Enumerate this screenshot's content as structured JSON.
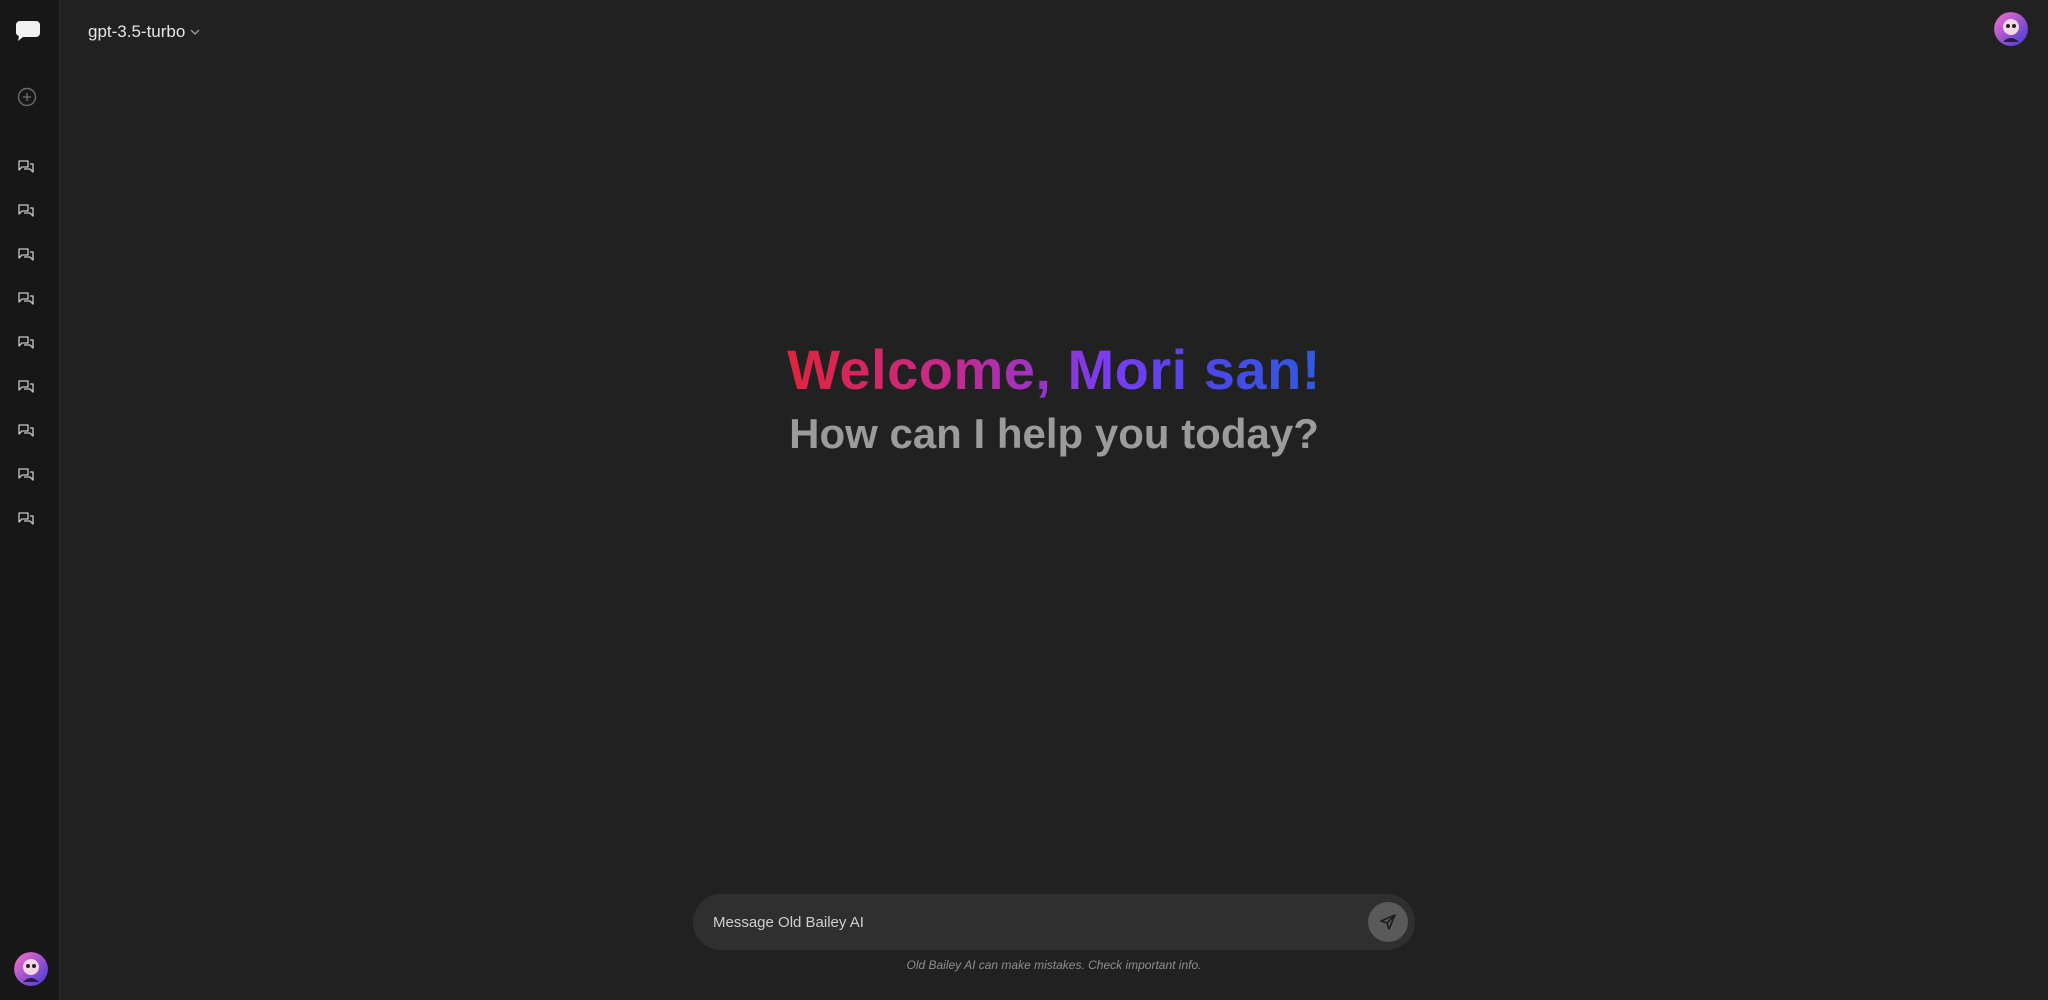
{
  "header": {
    "model": "gpt-3.5-turbo",
    "chevron_icon": "chevron-down-icon"
  },
  "sidebar": {
    "logo_icon": "chat-bubble-logo-icon",
    "new_chat_icon": "plus-circle-icon",
    "chat_items": [
      {
        "icon": "chat-icon"
      },
      {
        "icon": "chat-icon"
      },
      {
        "icon": "chat-icon"
      },
      {
        "icon": "chat-icon"
      },
      {
        "icon": "chat-icon"
      },
      {
        "icon": "chat-icon"
      },
      {
        "icon": "chat-icon"
      },
      {
        "icon": "chat-icon"
      },
      {
        "icon": "chat-icon"
      }
    ]
  },
  "welcome": {
    "title": "Welcome, Mori san!",
    "subtitle": "How can I help you today?"
  },
  "composer": {
    "placeholder": "Message Old Bailey AI",
    "send_icon": "send-icon"
  },
  "disclaimer": "Old Bailey AI can make mistakes. Check important info.",
  "colors": {
    "background": "#212121",
    "sidebar": "#171717",
    "gradient": [
      "#e0243a",
      "#c52a8c",
      "#7a3cf0",
      "#2d5bde"
    ]
  }
}
